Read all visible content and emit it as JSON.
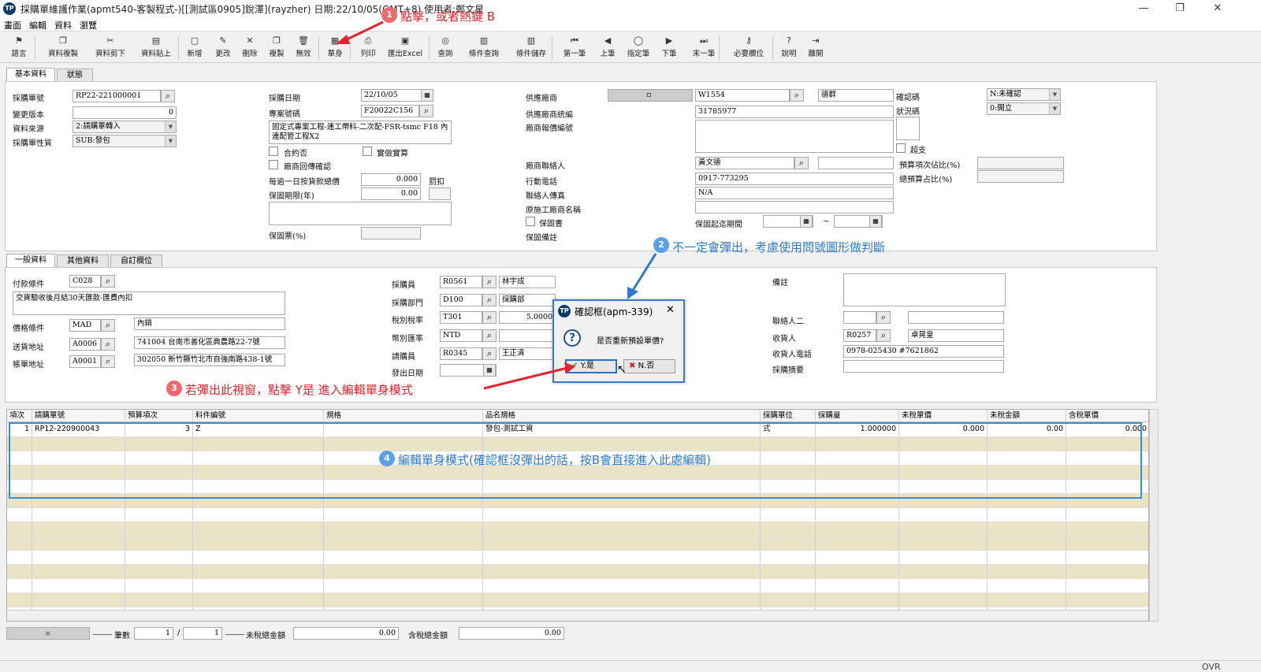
{
  "window": {
    "title": "採購單維護作業(apmt540-客製程式-)[[測試區0905]銳澤](rayzher)  日期:22/10/05(GMT+8)  使用者:鄭文星"
  },
  "menu": [
    "畫面",
    "編輯",
    "資料",
    "瀏覽"
  ],
  "toolbar": [
    {
      "label": "語言",
      "icon": "flag-icon",
      "glyph": "⚑"
    },
    {
      "label": "資料複製",
      "icon": "copy-icon",
      "glyph": "❐"
    },
    {
      "label": "資料剪下",
      "icon": "scissors-icon",
      "glyph": "✂"
    },
    {
      "label": "資料貼上",
      "icon": "paste-icon",
      "glyph": "▤"
    },
    {
      "label": "新增",
      "icon": "new-icon",
      "glyph": "▢"
    },
    {
      "label": "更改",
      "icon": "pencil-icon",
      "glyph": "✎"
    },
    {
      "label": "刪除",
      "icon": "delete-icon",
      "glyph": "✕"
    },
    {
      "label": "複製",
      "icon": "duplicate-icon",
      "glyph": "❐"
    },
    {
      "label": "無效",
      "icon": "trash-icon",
      "glyph": "🗑"
    },
    {
      "label": "單身",
      "icon": "detail-icon",
      "glyph": "▦"
    },
    {
      "label": "列印",
      "icon": "print-icon",
      "glyph": "⎙"
    },
    {
      "label": "匯出Excel",
      "icon": "export-excel-icon",
      "glyph": "▣"
    },
    {
      "label": "查詢",
      "icon": "binoculars-icon",
      "glyph": "◎"
    },
    {
      "label": "條件查詢",
      "icon": "filter-query-icon",
      "glyph": "▥"
    },
    {
      "label": "條件儲存",
      "icon": "save-condition-icon",
      "glyph": "▥"
    },
    {
      "label": "第一筆",
      "icon": "first-icon",
      "glyph": "⏮"
    },
    {
      "label": "上筆",
      "icon": "prev-icon",
      "glyph": "◀"
    },
    {
      "label": "指定筆",
      "icon": "goto-icon",
      "glyph": "◯"
    },
    {
      "label": "下筆",
      "icon": "next-icon",
      "glyph": "▶"
    },
    {
      "label": "末一筆",
      "icon": "last-icon",
      "glyph": "⏭"
    },
    {
      "label": "必要欄位",
      "icon": "key-icon",
      "glyph": "⚷"
    },
    {
      "label": "說明",
      "icon": "help-icon",
      "glyph": "?"
    },
    {
      "label": "離開",
      "icon": "exit-icon",
      "glyph": "⇥"
    }
  ],
  "tabs_top": [
    "基本資料",
    "狀態"
  ],
  "tabs_mid": [
    "一般資料",
    "其他資料",
    "自訂欄位"
  ],
  "basic": {
    "po_no_label": "採購單號",
    "po_no": "RP22-221000001",
    "version_label": "變更版本",
    "version": "0",
    "source_label": "資料來源",
    "source": "2:請購單轉入",
    "nature_label": "採購單性質",
    "nature": "SUB:發包",
    "date_label": "採購日期",
    "date": "22/10/05",
    "project_label": "專案號碼",
    "project": "F20022C156",
    "project_desc": "固定式專案工程-連工帶料-二次配-FSR-tsmc F18 內連配管工程X2",
    "contract_label": "合約否",
    "actual_label": "實做實算",
    "reply_label": "廠商回傳確認",
    "penalty_label": "每逾一日按貨款總價",
    "penalty": "0.000",
    "penalty_unit": "罰扣",
    "warranty_label": "保固期限(年)",
    "warranty": "0.00",
    "warranty_pct_label": "保固票(%)",
    "vendor_label": "供應廠商",
    "vendor_code": "W1554",
    "vendor_name": "德群",
    "tax_id_label": "供應廠商統編",
    "tax_id": "31785977",
    "quote_label": "廠商報價編號",
    "contact_label": "廠商聯絡人",
    "contact": "黃文德",
    "mobile_label": "行動電話",
    "mobile": "0917-773295",
    "fax_label": "聯絡人傳真",
    "fax": "N/A",
    "orig_vendor_label": "原施工廠商名稱",
    "warranty_doc_label": "保固書",
    "warranty_period_label": "保固起迄期間",
    "tilde": "~",
    "warranty_note_label": "保固備註",
    "confirm_label": "確認碼",
    "confirm": "N:未確認",
    "status_label": "狀況碼",
    "status": "0:開立",
    "overpay_label": "超支",
    "budget_pct_label": "預算項次佔比(%)",
    "total_budget_pct_label": "總預算占比(%)"
  },
  "general": {
    "pay_label": "付款條件",
    "pay_code": "C028",
    "pay_desc": "交貨驗收後月結30天匯款-匯費內扣",
    "price_label": "價格條件",
    "price_code": "MAD",
    "price_desc": "內銷",
    "ship_label": "送貨地址",
    "ship_code": "A0006",
    "ship_addr": "741004 台南市善化區典農路22-7號",
    "bill_label": "帳單地址",
    "bill_code": "A0001",
    "bill_addr": "302050 新竹縣竹北市自強南路438-1號",
    "buyer_label": "採購員",
    "buyer_code": "R0561",
    "buyer_name": "林宇成",
    "dept_label": "採購部門",
    "dept_code": "D100",
    "dept_name": "採購部",
    "tax_label": "稅別稅率",
    "tax_code": "T301",
    "tax_rate": "5.0000",
    "currency_label": "幣別匯率",
    "currency": "NTD",
    "requester_label": "請購員",
    "requester_code": "R0345",
    "requester_name": "王正清",
    "issue_label": "發出日期",
    "remark_label": "備註",
    "contact2_label": "聯絡人二",
    "receiver_label": "收貨人",
    "receiver_code": "R0257",
    "receiver_name": "卓晃皇",
    "receiver_phone_label": "收貨人電話",
    "receiver_phone": "0978-025430 #7621862",
    "summary_label": "採購摘要"
  },
  "dialog": {
    "title": "確認框(apm-339)",
    "message": "是否重新預設單價?",
    "yes": "Y.是",
    "no": "N.否",
    "close": "✕"
  },
  "grid": {
    "headers": [
      "項次",
      "請購單號",
      "預算項次",
      "料件編號",
      "規格",
      "品名規格",
      "採購單位",
      "採購量",
      "未稅單價",
      "未稅金額",
      "含稅單價"
    ],
    "row": [
      "1",
      "RP12-220900043",
      "3",
      "Z",
      "",
      "發包-測試工資",
      "式",
      "1.000000",
      "0.000",
      "0.00",
      "0.000"
    ]
  },
  "footer": {
    "count_label": "筆數",
    "current": "1",
    "sep": "/",
    "total": "1",
    "untaxed_label": "未稅總金額",
    "untaxed": "0.00",
    "taxed_label": "含稅總金額",
    "taxed": "0.00"
  },
  "status": {
    "ovr": "OVR"
  },
  "annotations": {
    "a1": "點擊，或者熱鍵 B",
    "n1": "1",
    "a2": "不一定會彈出，考慮使用問號圖形做判斷",
    "n2": "2",
    "a3": "若彈出此視窗，點擊 Y是 進入編輯單身模式",
    "n3": "3",
    "a4": "編輯單身模式(確認框沒彈出的話，按B會直接進入此處編輯)",
    "n4": "4"
  }
}
